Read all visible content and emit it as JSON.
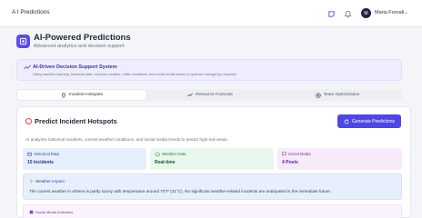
{
  "app": {
    "title": "A I Predictions"
  },
  "topbar": {
    "user_initials": "M",
    "user_name": "Maria Foroali",
    "chevron": "⌄"
  },
  "hero": {
    "title": "AI-Powered Predictions",
    "subtitle": "Advanced analytics and decision support"
  },
  "banner": {
    "title": "AI-Driven Decision Support System",
    "description": "Using machine learning, historical data, real-time weather, traffic conditions, and social media trends to optimize emergency response"
  },
  "tabs": [
    {
      "label": "Incident Hotspots",
      "icon": "pin-icon",
      "active": true
    },
    {
      "label": "Resource Forecast",
      "icon": "trend-icon",
      "active": false
    },
    {
      "label": "Team Optimization",
      "icon": "target-icon",
      "active": false
    }
  ],
  "panel": {
    "title": "Predict Incident Hotspots",
    "button_label": "Generate Predictions",
    "description": "AI analyzes historical incidents, current weather conditions, and social media trends to predict high-risk areas.",
    "cards": [
      {
        "label": "Historical Data",
        "value": "10 Incidents",
        "color": "#2b4c9b",
        "bg": "#e8effc"
      },
      {
        "label": "Weather Data",
        "value": "Real-time",
        "color": "#237a3b",
        "bg": "#e9f7ec"
      },
      {
        "label": "Social Media",
        "value": "4 Posts",
        "color": "#7e2d91",
        "bg": "#f7ebfb"
      }
    ],
    "weather_label": "Weather Impact:",
    "weather_text": "The current weather in Athens is partly sunny with temperature around 70°F (21°C). No significant weather-related incidents are anticipated in the immediate future.",
    "social_label": "Social Media Indicators"
  },
  "colors": {
    "accent": "#4f46e5",
    "hero_icon": "#5b4ee6"
  }
}
